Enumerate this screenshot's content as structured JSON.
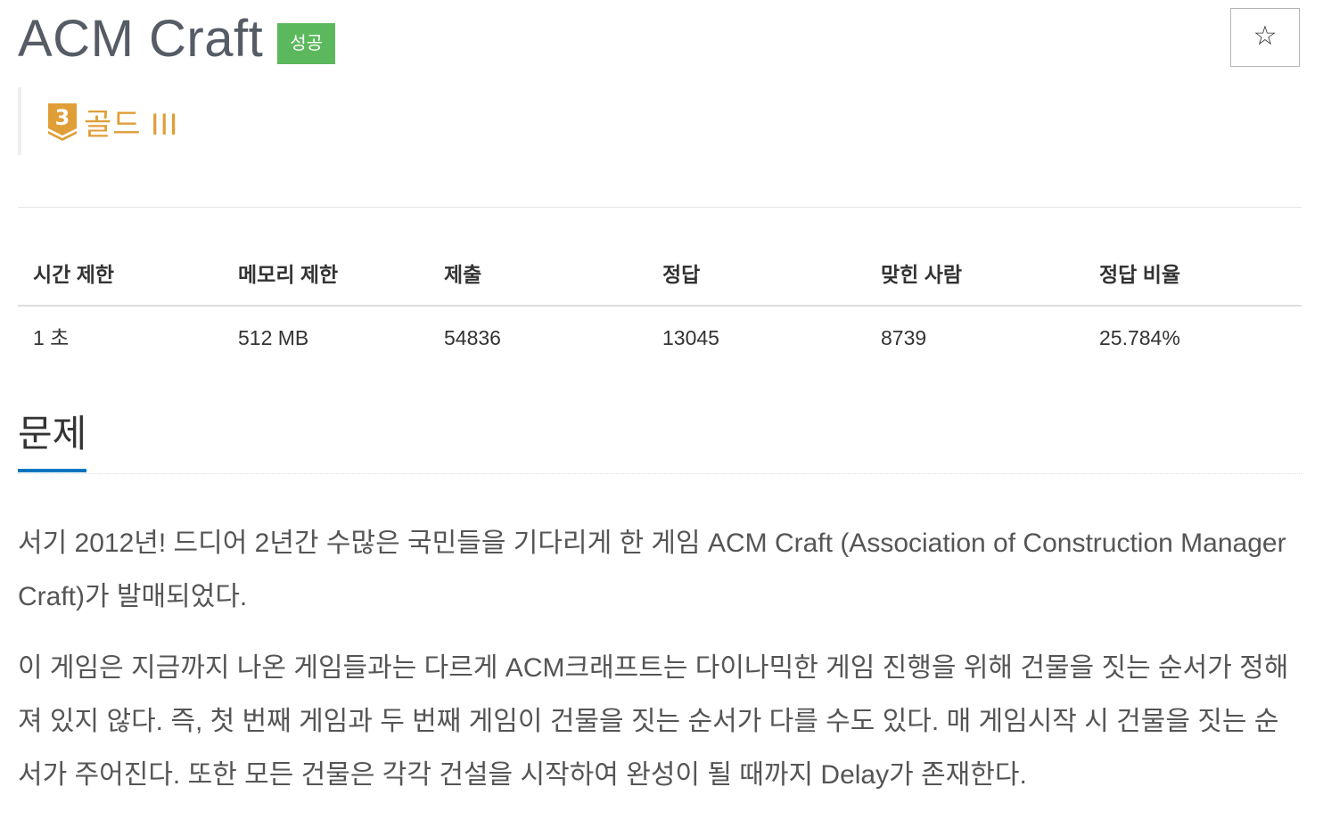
{
  "problem": {
    "title": "ACM Craft",
    "result_badge": "성공",
    "star_icon": "☆",
    "tier": {
      "number": "3",
      "label": "골드 III",
      "color": "#e09e37"
    }
  },
  "stats": {
    "headers": [
      "시간 제한",
      "메모리 제한",
      "제출",
      "정답",
      "맞힌 사람",
      "정답 비율"
    ],
    "values": [
      "1 초",
      "512 MB",
      "54836",
      "13045",
      "8739",
      "25.784%"
    ]
  },
  "section": {
    "title": "문제"
  },
  "description": {
    "paragraphs": [
      "서기 2012년! 드디어 2년간 수많은 국민들을 기다리게 한 게임 ACM Craft (Association of Construction Manager Craft)가 발매되었다.",
      "이 게임은 지금까지 나온 게임들과는 다르게 ACM크래프트는 다이나믹한 게임 진행을 위해 건물을 짓는 순서가 정해져 있지 않다. 즉, 첫 번째 게임과 두 번째 게임이 건물을 짓는 순서가 다를 수도 있다. 매 게임시작 시 건물을 짓는 순서가 주어진다. 또한 모든 건물은 각각 건설을 시작하여 완성이 될 때까지 Delay가 존재한다."
    ]
  },
  "colors": {
    "success": "#5cb85c",
    "gold": "#e09e37",
    "accent": "#0076c0"
  }
}
